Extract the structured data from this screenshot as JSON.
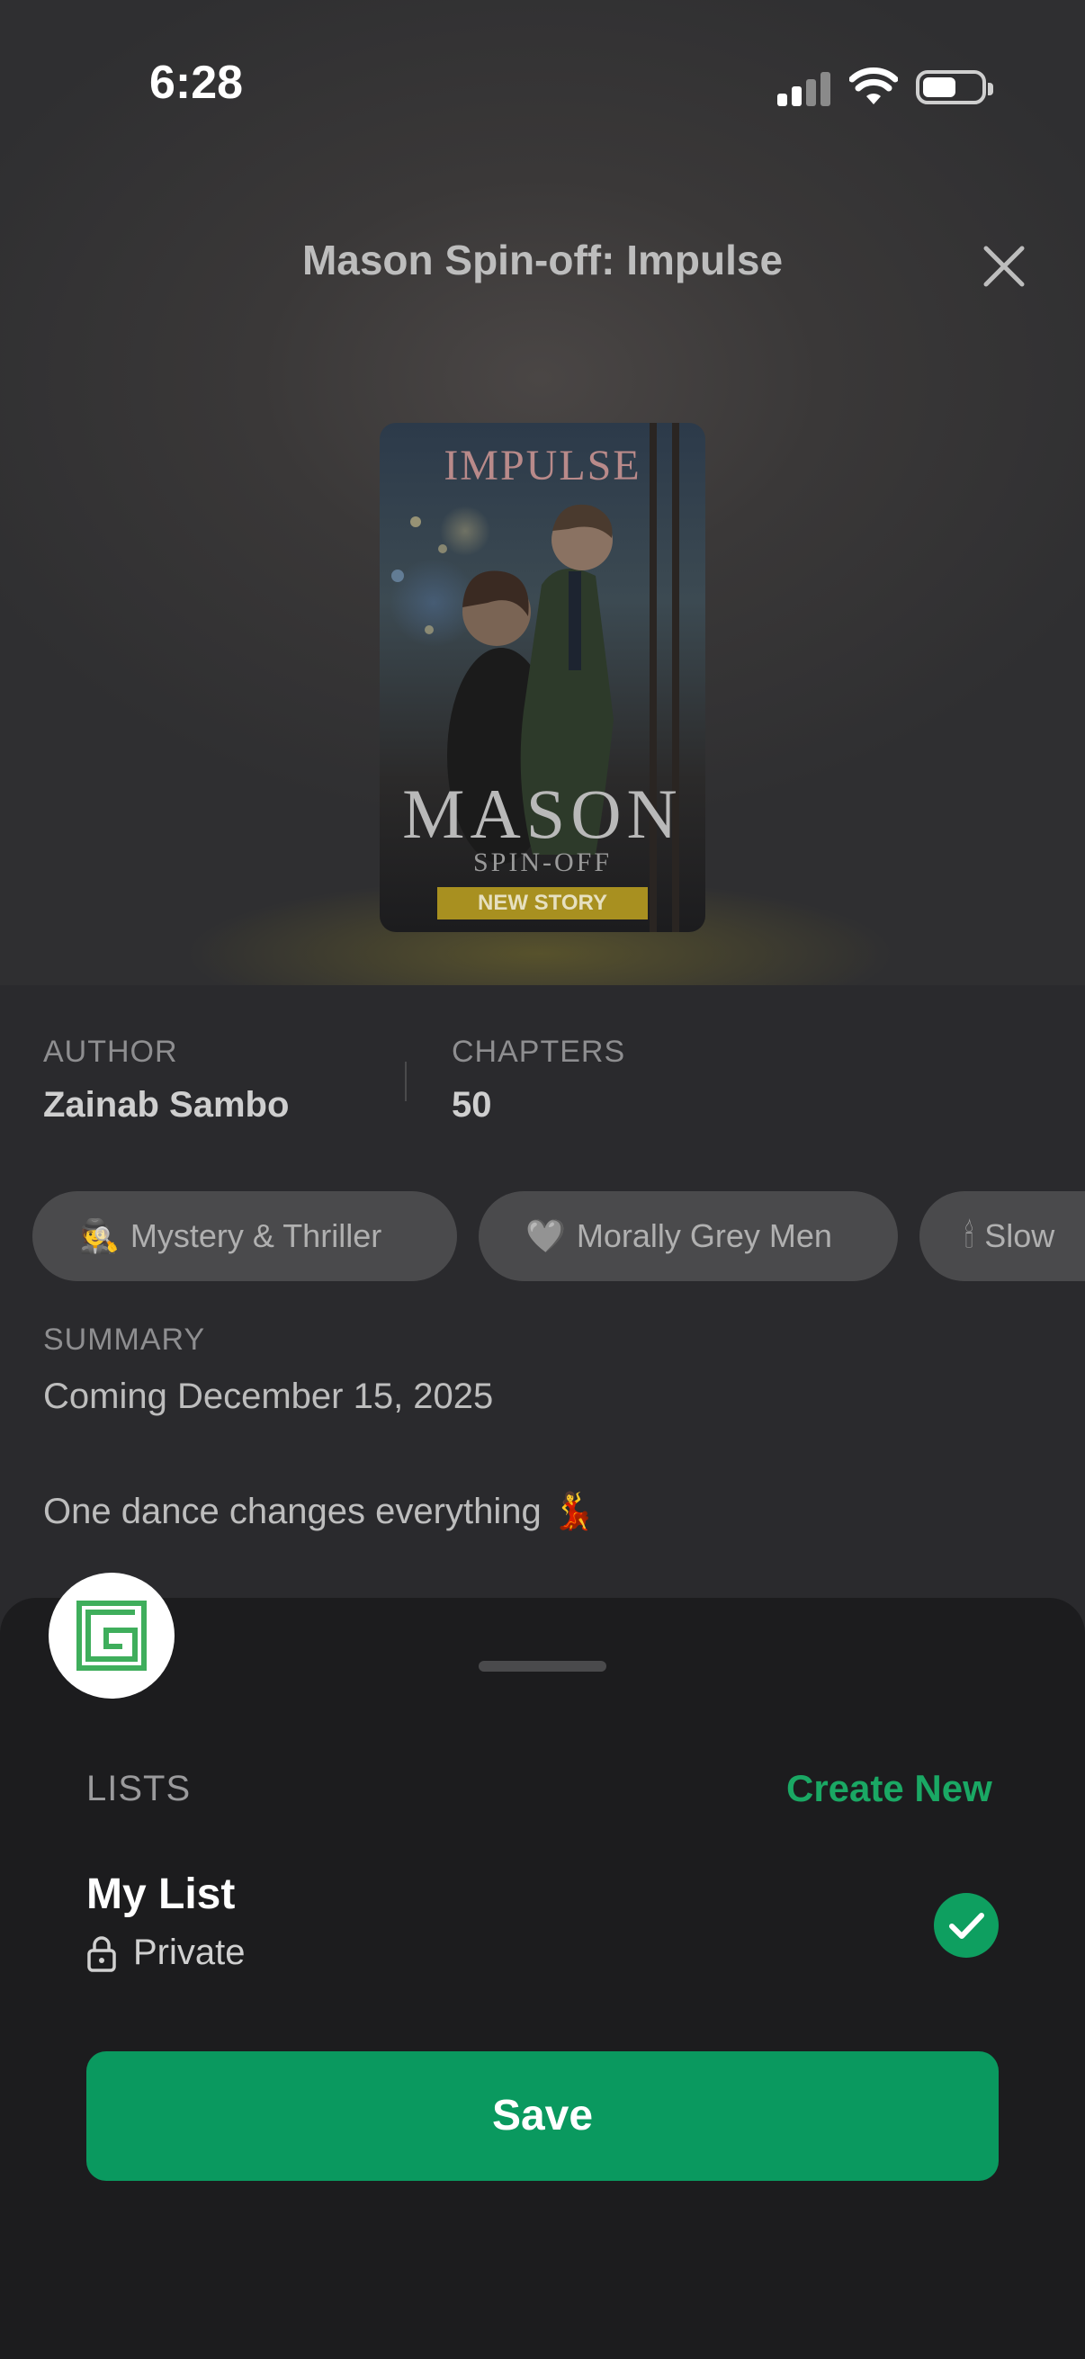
{
  "status_bar": {
    "time": "6:28",
    "signal_icon": "cellular-signal-icon",
    "wifi_icon": "wifi-icon",
    "battery_icon": "battery-icon"
  },
  "header": {
    "title": "Mason Spin-off: Impulse",
    "close_icon": "close-icon"
  },
  "cover": {
    "top_title": "IMPULSE",
    "main_title": "MASON",
    "subtitle": "SPIN-OFF",
    "badge": "NEW STORY"
  },
  "meta": {
    "author_label": "AUTHOR",
    "author_value": "Zainab Sambo",
    "chapters_label": "CHAPTERS",
    "chapters_value": "50"
  },
  "tags": [
    {
      "icon": "🕵",
      "label": "Mystery & Thriller"
    },
    {
      "icon": "🩶",
      "label": "Morally Grey Men"
    },
    {
      "icon": "🕯",
      "label": "Slow"
    }
  ],
  "summary": {
    "label": "SUMMARY",
    "line1": "Coming December 15, 2025",
    "line2": "One dance changes everything 💃"
  },
  "sheet": {
    "app_icon": "app-logo-icon",
    "lists_label": "LISTS",
    "create_new": "Create New",
    "list": {
      "name": "My List",
      "privacy": "Private",
      "checked": true
    },
    "save_label": "Save"
  },
  "colors": {
    "accent": "#0a995f",
    "link": "#1aa864",
    "sheet_bg": "#1c1c1e"
  }
}
